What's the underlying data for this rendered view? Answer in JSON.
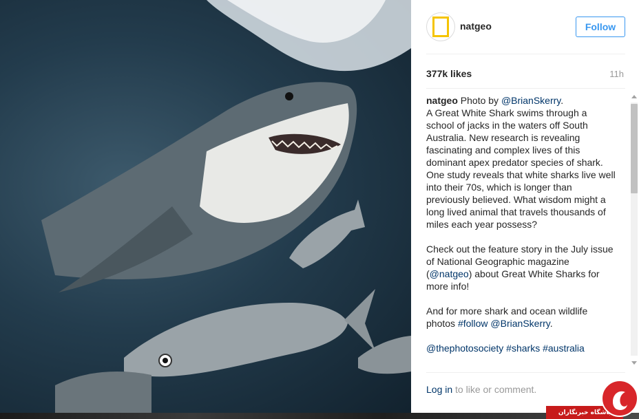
{
  "photo": {
    "description_icon": "great-white-shark-photo"
  },
  "post": {
    "username": "natgeo",
    "follow_label": "Follow",
    "avatar_text": "NATIONAL GEOGRAPHIC",
    "likes": "377k likes",
    "time": "11h"
  },
  "caption": {
    "owner": "natgeo",
    "p1_prefix": " Photo by ",
    "p1_mention": "@BrianSkerry",
    "p1_suffix": ".",
    "p1_body": "A Great White Shark swims through a school of jacks in the waters off South Australia. New research is revealing fascinating and complex lives of this dominant apex predator species of shark. One study reveals that white sharks live well into their 70s, which is longer than previously believed. What wisdom might a long lived animal that travels thousands of miles each year possess?",
    "p2_prefix": "Check out the feature story in the July issue of National Geographic magazine (",
    "p2_mention": "@natgeo",
    "p2_suffix": ") about Great White Sharks for more info!",
    "p3_prefix": "And for more shark and ocean wildlife photos ",
    "p3_tag": "#follow",
    "p3_space": " ",
    "p3_mention": "@BrianSkerry",
    "p3_suffix": ".",
    "p4_mention": "@thephotosociety",
    "p4_tag1": "#sharks",
    "p4_tag2": "#australia"
  },
  "footer": {
    "login_label": "Log in",
    "login_suffix": " to like or comment."
  },
  "watermark": {
    "text": "باشگاه خبرنگاران"
  },
  "colors": {
    "link": "#003569",
    "follow_blue": "#3897f0",
    "watermark_red": "#c71b1b"
  }
}
